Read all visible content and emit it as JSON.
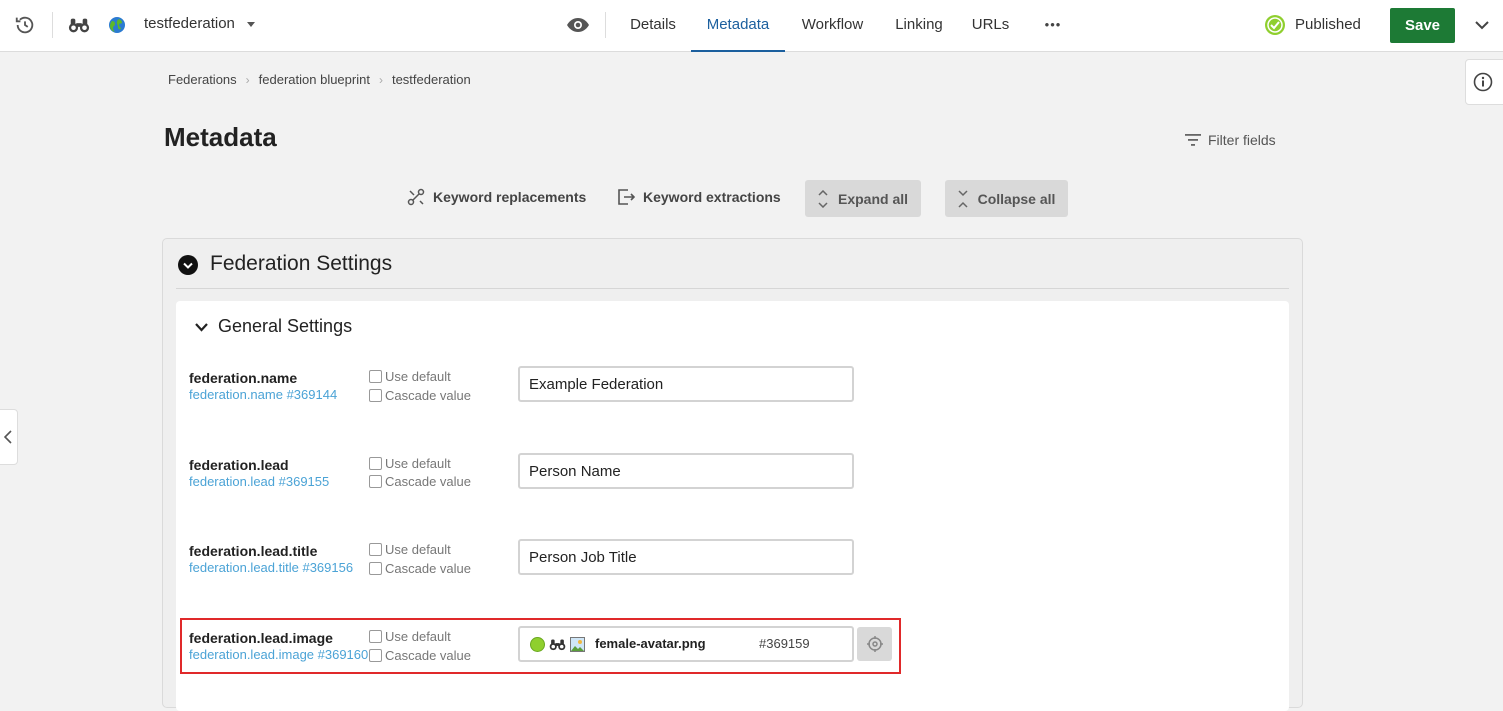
{
  "topbar": {
    "site_name": "testfederation",
    "tabs": [
      {
        "label": "Details"
      },
      {
        "label": "Metadata"
      },
      {
        "label": "Workflow"
      },
      {
        "label": "Linking"
      },
      {
        "label": "URLs"
      }
    ],
    "active_tab": "Metadata",
    "more_label": "•••",
    "status": "Published",
    "save_label": "Save",
    "accent_color": "#1b5f9e",
    "save_color": "#1d7a35",
    "status_color": "#8fcf2e"
  },
  "breadcrumb": [
    "Federations",
    "federation blueprint",
    "testfederation"
  ],
  "page": {
    "title": "Metadata",
    "filter_label": "Filter fields"
  },
  "actions": {
    "keyword_replacements": "Keyword replacements",
    "keyword_extractions": "Keyword extractions",
    "expand_all": "Expand all",
    "collapse_all": "Collapse all"
  },
  "section": {
    "title": "Federation Settings",
    "group": {
      "title": "General Settings",
      "fields": [
        {
          "name": "federation.name",
          "link": "federation.name #369144",
          "use_default": "Use default",
          "cascade": "Cascade value",
          "value": "Example Federation"
        },
        {
          "name": "federation.lead",
          "link": "federation.lead #369155",
          "use_default": "Use default",
          "cascade": "Cascade value",
          "value": "Person Name"
        },
        {
          "name": "federation.lead.title",
          "link": "federation.lead.title #369156",
          "use_default": "Use default",
          "cascade": "Cascade value",
          "value": "Person Job Title"
        },
        {
          "name": "federation.lead.image",
          "link": "federation.lead.image #369160",
          "use_default": "Use default",
          "cascade": "Cascade value",
          "asset_name": "female-avatar.png",
          "asset_id": "#369159"
        }
      ]
    }
  },
  "highlight_color": "#e0292a"
}
